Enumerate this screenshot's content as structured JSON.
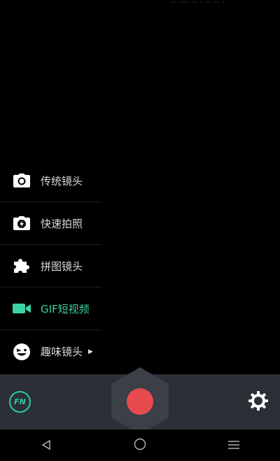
{
  "status_watermark": "·· ···· ·· · ·· ·· ·",
  "menu": {
    "items": [
      {
        "label": "传统镜头",
        "icon": "camera-icon"
      },
      {
        "label": "快速拍照",
        "icon": "quick-camera-icon"
      },
      {
        "label": "拼图镜头",
        "icon": "puzzle-icon"
      },
      {
        "label": "GIF短视频",
        "icon": "video-camera-icon",
        "active": true
      },
      {
        "label": "趣味镜头",
        "icon": "funny-face-icon",
        "has_submenu": true
      }
    ],
    "submenu_arrow": "▶"
  },
  "toolbar": {
    "fn_label": "FN",
    "shutter_color": "#e84b4f",
    "accent_color": "#2ec9a0",
    "bar_color": "#2b3036"
  },
  "nav": {
    "back_icon": "back-triangle-icon",
    "home_icon": "home-circle-icon",
    "menu_icon": "menu-lines-icon"
  }
}
